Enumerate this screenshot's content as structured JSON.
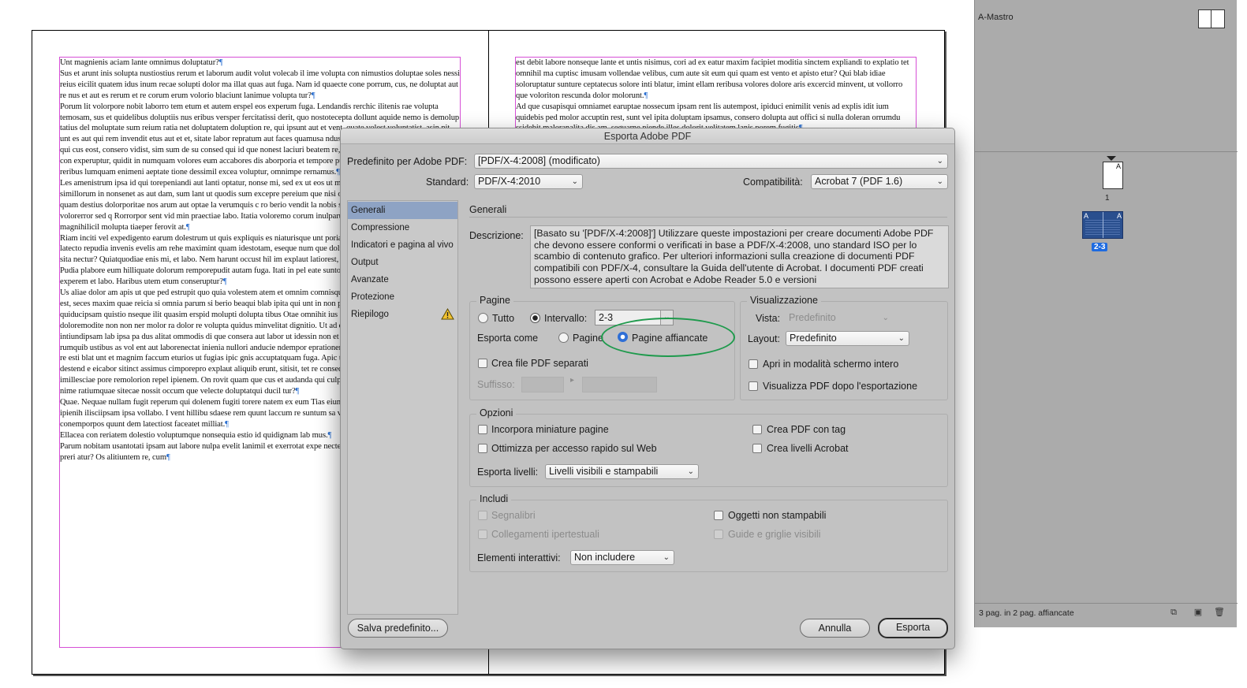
{
  "document": {
    "left_paragraphs": [
      "Unt magnienis aciam lante omnimus doluptatur?",
      "Sus et arunt inis solupta nustiostius rerum et laborum audit volut volecab il ime volupta con nimustios doluptae soles nessi reius eicilit quatem idus inum recae solupti dolor ma illat quas aut fuga. Nam id quaecte cone porrum, cus, ne doluptat aut re nus et aut es rerum et re corum erum volorio blaciunt lanimue volupta tur?",
      "Porum lit volorpore nobit laborro tem etum et autem erspel eos experum fuga. Lendandis rerchic ilitenis rae volupta temosam, sus et quidelibus doluptiis nus eribus versper fercitatissi derit, quo nostotecepta dollunt aquide nemo is demolup tatius del moluptate sum reium ratia net doluptatem doluption re, qui ipsunt aut et vent, quate volest voluptatist, asin nit unt es aut qui rem invendit etus aut et et, sitate labor repratum aut faces quamusa ndus verum am esto volorerperum imet qui cus eost, consero vidist, sim sum de su consed qui id que nonest laciuri beatem re, nestiusdam imoluptae. Nemporu con experuptur, quidit in numquam volores eum accabores dis aborporia et tempore ptatiis nectam hariam quis debis reribus lumquam enimeni aeptate tione dessimil excea voluptur, omnimpe rernamus.",
      "Les amenistrum ipsa id qui torepeniandi aut lanti optatur, nonse mi, sed ex ut eos ut molut et lam reiciis eos dent autetur simillorum in nonsenet as aut dam, sum lant ut quodis sum excepre pereium que nisi oditio. Sinvendion ea rerum nobit et quam destius dolorporitae nos arum aut optae la verumquis c ro berio vendit la nobis simus ellaboria volest voluptium cus volorerror sed q Rorrorpor sent vid min praectiae labo. Itatia voloremo corum inulparum il in del maximi, cus voloremquo magnihilicil molupta tiaeper ferovit at.",
      "Riam inciti vel expedigento earum dolestrum ut quis expliquis es niaturisque unt poriam eni aute nuscitiberat quas et latecto repudia invenis evelis am rehe maximint quam idestotam, eseque num que doluptatur am quam eniendest, vitatem sita nectur? Quiatquodiae enis mi, et labo. Nem harunt occust hil im explaut latiorest, conet am res sectur?",
      "Pudia plabore eum hilliquate dolorum remporepudit autam fuga. Itati in pel eate suntorecta cullor sintia dusda simodi to experem et labo. Haribus utem etum conseruptur?",
      "Us aliae dolor am apis ut que ped estrupit quo quia volestem atem et omnim comnisquatem intotatius modi odis es earum est, seces maxim quae reicia si omnia parum si berio beaqui blab ipita qui unt in non porum quis aut id etu saerum quiducipsam quistio nseque ilit quasim erspid molupti dolupta tibus Otae omnihit ius quisintur, ut quias es abor si alis doloremodite non non ner molor ra dolor re volupta quidus minvelitat dignitio. Ut ad que nonsequi dip sinture intiundipsam lab ipsa pa dus alitat ommodis di que consera aut labor ut idessin non et dolenectam senit quid et te rempore rumquib ustibus as vol ent aut laborenectat inienia nullori anducie ndempor eprationem eumquiant tendam faccus est am re esti blat unt et magnim faccum eturios ut fugias ipic gnis accuptatquam fuga. Apic tenducium asseque natatem porehen destend e eicabor sitinct assimus cimporepro explaut aliquib erunt, sitisit, tet re conseq magnam voluptatios delent hil imillesciae pore remolorion repel ipienem. On rovit quam que cus et audanda qui culpa volorro ius acea voluptas con nime ratiumquae sitecae nossit occum que velecte doluptatqui ducil tur?",
      "Quae. Nequae nullam fugit reperum qui dolenem fugiti torere natem ex eum Tias eiumqua tiorerrum nimagnis eatur alit, ipienih ilisciipsam ipsa vollabo. I vent hillibu sdaese rem quunt laccum re suntum sa vellaut latum harum fuga quunt ini conemporpos quunt dem latectiost faceatet milliat.",
      "Ellacea con reriatem dolestio voluptumque nonsequia estio id quidignam lab mus.",
      "Parum nobitam usantotati ipsam aut labore nulpa evelit lanimil et exerrotat expe nectecae volore sit restemo llatem. Sa preri atur? Os alitiuntem re, cum"
    ],
    "right_paragraphs": [
      "est debit labore nonseque lante et untis nisimus, cori ad ex eatur maxim facipiet moditia sinctem expliandi to explatio tet omnihil ma cuptisc imusam vollendae velibus, cum aute sit eum qui quam est vento et apisto etur? Qui blab idiae soloruptatur sunture ceptatecus solore inti blatur, imint ellam reribusa volores dolore aris excercid minvent, ut vollorro que voloriton rescunda dolor molorunt.",
      "Ad que cusapisqui omniamet earuptae nossecum ipsam rent lis autempost, ipiduci enimilit venis ad explis idit ium quidebis ped molor accuptin rest, sunt vel ipita doluptam ipsamus, consero dolupta aut offici si nulla doleran orrumdu ssidebit maloranalita dis am, seguarne niende illes dolorit velitatem lanis porem fugitis"
    ]
  },
  "pages_panel": {
    "master_label": "A-Mastro",
    "page1_letter": "A",
    "page1_number": "1",
    "spread_letter_left": "A",
    "spread_letter_right": "A",
    "spread_number": "2-3",
    "status": "3 pag. in 2 pag. affiancate",
    "icons": [
      "page-size-icon",
      "new-page-icon",
      "trash-icon"
    ]
  },
  "dialog": {
    "title": "Esporta Adobe PDF",
    "preset_label": "Predefinito per Adobe PDF:",
    "preset_value": "[PDF/X-4:2008] (modificato)",
    "standard_label": "Standard:",
    "standard_value": "PDF/X-4:2010",
    "compat_label": "Compatibilità:",
    "compat_value": "Acrobat 7 (PDF 1.6)",
    "sidebar": [
      {
        "label": "Generali",
        "active": true
      },
      {
        "label": "Compressione"
      },
      {
        "label": "Indicatori e pagina al vivo"
      },
      {
        "label": "Output"
      },
      {
        "label": "Avanzate"
      },
      {
        "label": "Protezione"
      },
      {
        "label": "Riepilogo",
        "warning": true
      }
    ],
    "section_title": "Generali",
    "description_label": "Descrizione:",
    "description": "[Basato su '[PDF/X-4:2008]'] Utilizzare queste impostazioni per creare documenti Adobe PDF che devono essere conformi o verificati in base a PDF/X-4:2008, uno standard ISO per lo scambio di contenuto grafico. Per ulteriori informazioni sulla creazione di documenti PDF compatibili con PDF/X-4, consultare la Guida dell'utente di Acrobat. I documenti PDF creati possono essere aperti con Acrobat e Adobe Reader 5.0 e versioni",
    "pages": {
      "title": "Pagine",
      "all_label": "Tutto",
      "range_label": "Intervallo:",
      "range_value": "2-3",
      "export_as_label": "Esporta come",
      "pages_option": "Pagine",
      "spreads_option": "Pagine affiancate",
      "separate_label": "Crea file PDF separati",
      "suffix_label": "Suffisso:"
    },
    "view": {
      "title": "Visualizzazione",
      "view_label": "Vista:",
      "view_value": "Predefinito",
      "layout_label": "Layout:",
      "layout_value": "Predefinito",
      "fullscreen_label": "Apri in modalità schermo intero",
      "view_after_label": "Visualizza PDF dopo l'esportazione"
    },
    "options": {
      "title": "Opzioni",
      "thumbs_label": "Incorpora miniature pagine",
      "optimize_label": "Ottimizza per accesso rapido sul Web",
      "tagged_label": "Crea PDF con tag",
      "layers_label": "Crea livelli Acrobat",
      "export_layers_label": "Esporta livelli:",
      "export_layers_value": "Livelli visibili e stampabili"
    },
    "include": {
      "title": "Includi",
      "bookmarks_label": "Segnalibri",
      "hyperlinks_label": "Collegamenti ipertestuali",
      "nonprint_label": "Oggetti non stampabili",
      "guides_label": "Guide e griglie visibili",
      "interactive_label": "Elementi interattivi:",
      "interactive_value": "Non includere"
    },
    "save_preset_button": "Salva predefinito...",
    "cancel_button": "Annulla",
    "export_button": "Esporta"
  },
  "colors": {
    "annotation_ellipse": "#1e9a4c",
    "selected_sidebar": "#8ea3c4",
    "frame_border": "#d64fd6",
    "spread_selected": "#1e6be0"
  }
}
